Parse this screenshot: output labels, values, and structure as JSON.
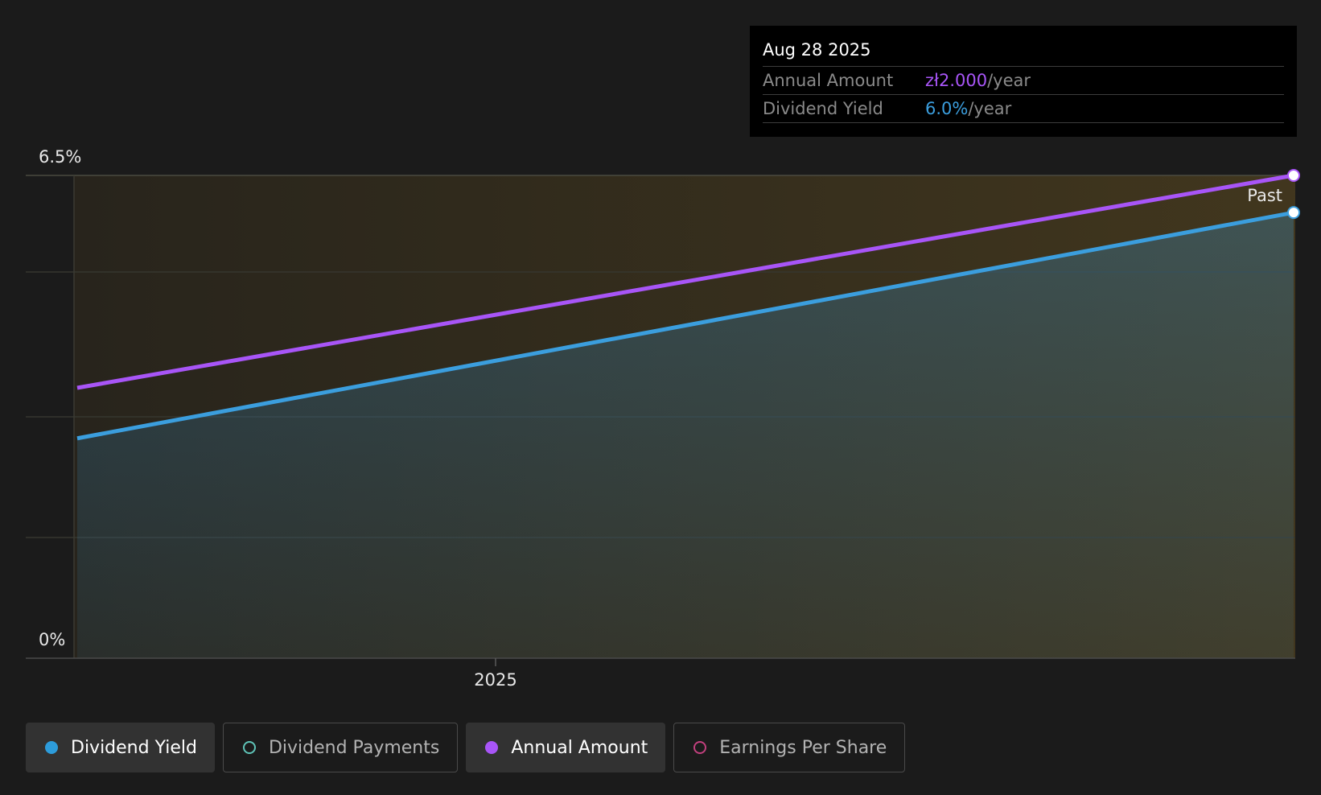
{
  "chart_data": {
    "type": "line",
    "y_axis": {
      "min_label": "0%",
      "max_label": "6.5%",
      "ylim": [
        0,
        6.5
      ]
    },
    "x_axis": {
      "tick_labels": [
        "2025"
      ]
    },
    "grid": true,
    "annotation": "Past",
    "series": [
      {
        "name": "Annual Amount",
        "color": "#a855f7",
        "unit": "zł",
        "values": [
          {
            "x": "2024-09",
            "y": 1.0
          },
          {
            "x": "2025-08-28",
            "y": 2.0
          }
        ]
      },
      {
        "name": "Dividend Yield",
        "color": "#3b9ede",
        "unit": "%",
        "values": [
          {
            "x": "2024-09",
            "y": 2.96
          },
          {
            "x": "2025-08-28",
            "y": 6.0
          }
        ]
      }
    ]
  },
  "tooltip": {
    "date": "Aug 28 2025",
    "rows": [
      {
        "label": "Annual Amount",
        "value": "zł2.000",
        "unit": "/year",
        "color": "#a855f7"
      },
      {
        "label": "Dividend Yield",
        "value": "6.0%",
        "unit": "/year",
        "color": "#3b9ede"
      }
    ]
  },
  "legend": [
    {
      "label": "Dividend Yield",
      "color": "#2d9cdb",
      "filled": true,
      "active": true
    },
    {
      "label": "Dividend Payments",
      "color": "#5fc4b8",
      "filled": false,
      "active": false
    },
    {
      "label": "Annual Amount",
      "color": "#a855f7",
      "filled": true,
      "active": true
    },
    {
      "label": "Earnings Per Share",
      "color": "#c2407e",
      "filled": false,
      "active": false
    }
  ]
}
